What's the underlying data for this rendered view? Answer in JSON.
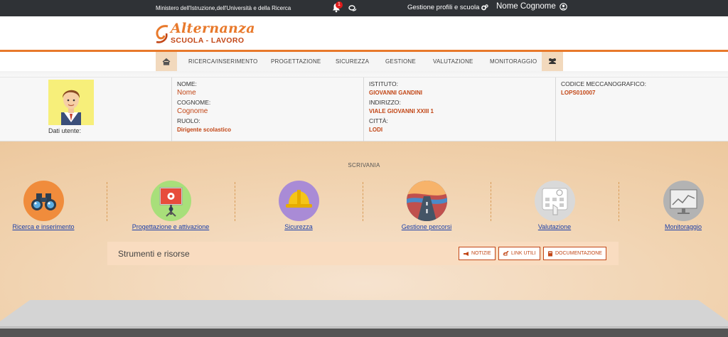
{
  "topbar": {
    "ministry": "Ministero dell'Istruzione,dell'Università e della Ricerca",
    "notifications_count": "1",
    "profiles_label": "Gestione profili e scuola",
    "user_name": "Nome Cognome"
  },
  "logo": {
    "line1": "Alternanza",
    "line2": "SCUOLA - LAVORO"
  },
  "nav": {
    "items": [
      "RICERCA/INSERIMENTO",
      "PROGETTAZIONE",
      "SICUREZZA",
      "GESTIONE",
      "VALUTAZIONE",
      "MONITORAGGIO"
    ]
  },
  "user_info": {
    "dati_label": "Dati utente:",
    "nome_label": "NOME:",
    "nome": "Nome",
    "cognome_label": "COGNOME:",
    "cognome": "Cognome",
    "ruolo_label": "RUOLO:",
    "ruolo": "Dirigente scolastico",
    "istituto_label": "ISTITUTO:",
    "istituto": "GIOVANNI GANDINI",
    "indirizzo_label": "INDIRIZZO:",
    "indirizzo": "VIALE GIOVANNI XXIII 1",
    "citta_label": "CITTÀ:",
    "citta": "LODI",
    "codice_label": "CODICE MECCANOGRAFICO:",
    "codice": "LOPS010007"
  },
  "desk": {
    "title": "SCRIVANIA",
    "tiles": [
      {
        "label": "Ricerca e inserimento",
        "icon": "binoculars-icon",
        "color": "#f08c3c"
      },
      {
        "label": "Progettazione e attivazione",
        "icon": "presentation-icon",
        "color": "#a8df7a"
      },
      {
        "label": "Sicurezza",
        "icon": "hardhat-icon",
        "color": "#a98bd6"
      },
      {
        "label": "Gestione percorsi",
        "icon": "road-icon",
        "color": "#3f6fa8"
      },
      {
        "label": "Valutazione",
        "icon": "touchscreen-icon",
        "color": "#d9d9d9"
      },
      {
        "label": "Monitoraggio",
        "icon": "monitor-chart-icon",
        "color": "#b3b3b3"
      }
    ]
  },
  "tools": {
    "title": "Strumenti e risorse",
    "buttons": [
      "NOTIZIE",
      "LINK UTILI",
      "DOCUMENTAZIONE"
    ]
  },
  "colors": {
    "accent": "#e8792b",
    "value_text": "#c24616",
    "topbar": "#2f3236",
    "link": "#1c3fa8"
  }
}
